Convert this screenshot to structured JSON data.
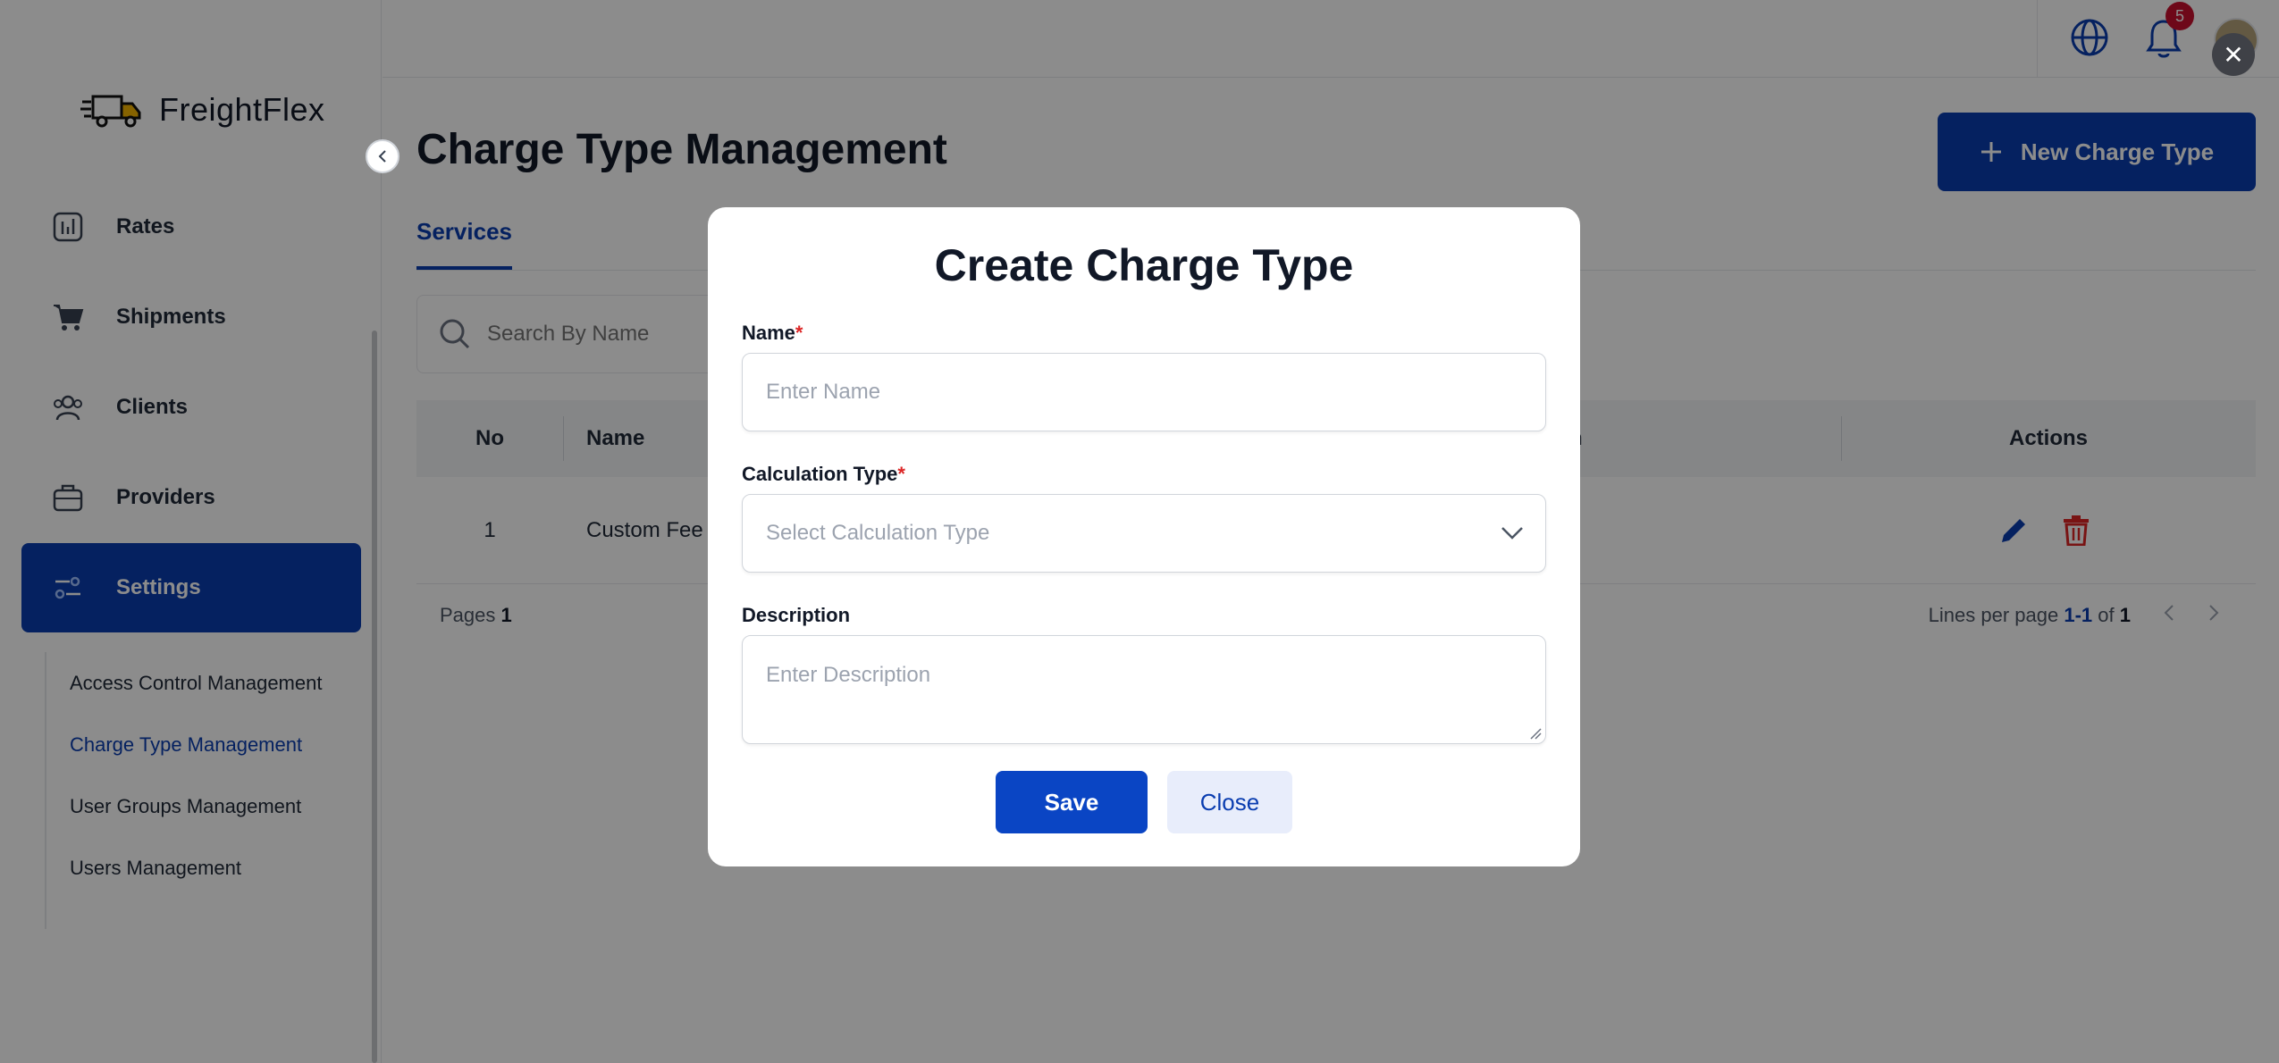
{
  "app": {
    "name": "FreightFlex"
  },
  "sidebar": {
    "items": [
      {
        "label": "Rates",
        "icon": "chart-icon"
      },
      {
        "label": "Shipments",
        "icon": "cart-icon"
      },
      {
        "label": "Clients",
        "icon": "users-icon"
      },
      {
        "label": "Providers",
        "icon": "briefcase-icon"
      },
      {
        "label": "Settings",
        "icon": "sliders-icon",
        "active": true
      }
    ],
    "subitems": [
      {
        "label": "Access Control Management"
      },
      {
        "label": "Charge Type Management",
        "active": true
      },
      {
        "label": "User Groups Management"
      },
      {
        "label": "Users Management"
      }
    ]
  },
  "topbar": {
    "notification_count": "5",
    "close_symbol": "✕"
  },
  "main": {
    "title": "Charge Type Management",
    "new_button": "New Charge Type",
    "tabs": [
      {
        "label": "Services"
      }
    ],
    "search_placeholder": "Search By Name",
    "table": {
      "headers": {
        "no": "No",
        "name": "Name",
        "description_partial": "n",
        "actions": "Actions"
      },
      "rows": [
        {
          "no": "1",
          "name": "Custom Fee"
        }
      ]
    },
    "footer": {
      "pages_label": "Pages",
      "pages_value": "1",
      "lines_label": "Lines per page",
      "range": "1-1",
      "of": "of",
      "total": "1"
    }
  },
  "modal": {
    "title": "Create Charge Type",
    "name_label": "Name",
    "name_placeholder": "Enter Name",
    "calc_label": "Calculation Type",
    "calc_placeholder": "Select Calculation Type",
    "desc_label": "Description",
    "desc_placeholder": "Enter Description",
    "required_mark": "*",
    "save": "Save",
    "close": "Close"
  },
  "colors": {
    "primary": "#0a3db0",
    "danger": "#dc2626",
    "badge": "#c8102e"
  }
}
